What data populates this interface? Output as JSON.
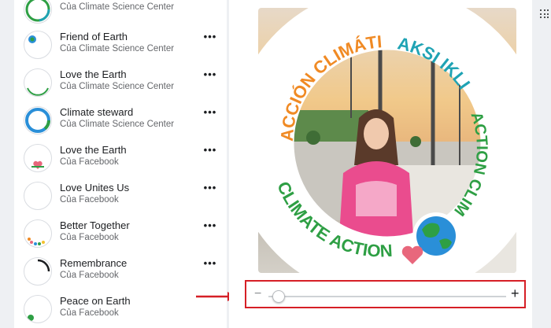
{
  "frames": [
    {
      "name": "",
      "owner": "Của Climate Science Center",
      "thumb": "earth-ring"
    },
    {
      "name": "Friend of Earth",
      "owner": "Của Climate Science Center",
      "thumb": "earth-small"
    },
    {
      "name": "Love the Earth",
      "owner": "Của Climate Science Center",
      "thumb": "bottom-arc"
    },
    {
      "name": "Climate steward",
      "owner": "Của Climate Science Center",
      "thumb": "blue-ring"
    },
    {
      "name": "Love the Earth",
      "owner": "Của Facebook",
      "thumb": "heart"
    },
    {
      "name": "Love Unites Us",
      "owner": "Của Facebook",
      "thumb": "plain"
    },
    {
      "name": "Better Together",
      "owner": "Của Facebook",
      "thumb": "colors"
    },
    {
      "name": "Remembrance",
      "owner": "Của Facebook",
      "thumb": "black-arc"
    },
    {
      "name": "Peace on Earth",
      "owner": "Của Facebook",
      "thumb": "green-dot"
    }
  ],
  "more_icon": "•••",
  "preview": {
    "ring_texts": [
      "ACCIÓN CLIMÁTICA",
      "AKSI IKLIM",
      "ACTION CLIMAT",
      "CLIMATE ACTION"
    ],
    "colors": {
      "orange": "#f08a24",
      "teal": "#1fa3b4",
      "green": "#2e9f44",
      "heart": "#e8677c"
    }
  },
  "zoom": {
    "minus": "−",
    "plus": "+",
    "level": 0.04
  },
  "accent": {
    "highlight": "#d61f26"
  }
}
